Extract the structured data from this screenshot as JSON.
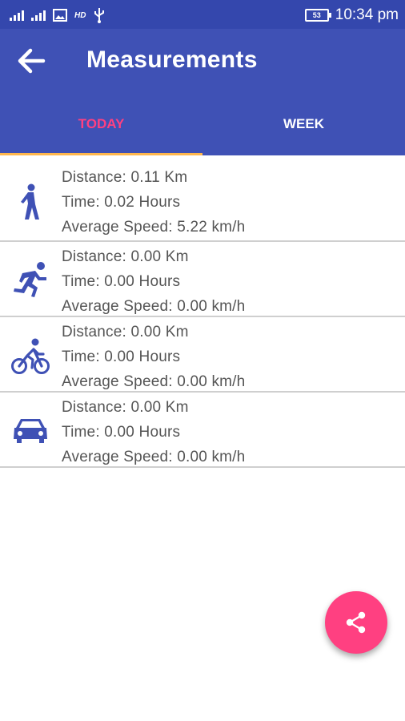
{
  "status_bar": {
    "time": "10:34 pm",
    "hd": "HD",
    "battery": "53"
  },
  "app_bar": {
    "title": "Measurements",
    "back_icon": "arrow-back-icon"
  },
  "tabs": [
    {
      "label": "TODAY",
      "active": true
    },
    {
      "label": "WEEK",
      "active": false
    }
  ],
  "measurements": [
    {
      "mode_icon": "walk-icon",
      "distance": "Distance: 0.11 Km",
      "time": "Time: 0.02 Hours",
      "speed": "Average Speed: 5.22 km/h"
    },
    {
      "mode_icon": "run-icon",
      "distance": "Distance: 0.00 Km",
      "time": "Time: 0.00 Hours",
      "speed": "Average Speed: 0.00 km/h"
    },
    {
      "mode_icon": "bike-icon",
      "distance": "Distance: 0.00 Km",
      "time": "Time: 0.00 Hours",
      "speed": "Average Speed: 0.00 km/h"
    },
    {
      "mode_icon": "car-icon",
      "distance": "Distance: 0.00 Km",
      "time": "Time: 0.00 Hours",
      "speed": "Average Speed: 0.00 km/h"
    }
  ],
  "fab": {
    "icon": "share-icon"
  },
  "colors": {
    "primary": "#3f51b5",
    "status": "#3447ad",
    "accent": "#ff4081",
    "indicator": "#ffb74d",
    "icon": "#3f51b5",
    "text": "#555555"
  }
}
